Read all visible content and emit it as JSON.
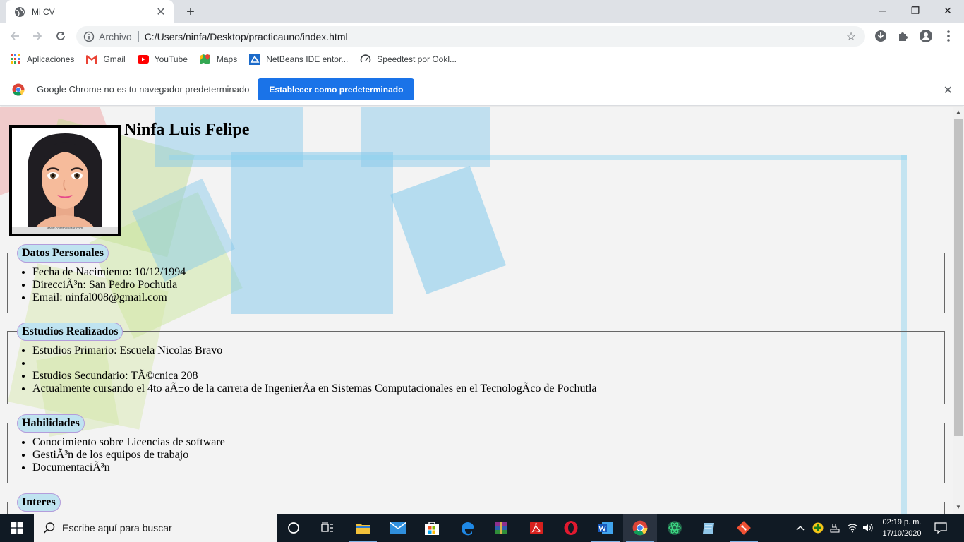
{
  "browser": {
    "tab_title": "Mi CV",
    "address_scheme": "Archivo",
    "address_url": "C:/Users/ninfa/Desktop/practicauno/index.html",
    "bookmarks": [
      {
        "label": "Aplicaciones",
        "icon": "apps-grid-icon"
      },
      {
        "label": "Gmail",
        "icon": "gmail-icon"
      },
      {
        "label": "YouTube",
        "icon": "youtube-icon"
      },
      {
        "label": "Maps",
        "icon": "maps-icon"
      },
      {
        "label": "NetBeans IDE entor...",
        "icon": "netbeans-icon"
      },
      {
        "label": "Speedtest por Ookl...",
        "icon": "speedtest-icon"
      }
    ],
    "infobar_message": "Google Chrome no es tu navegador predeterminado",
    "infobar_button": "Establecer como predeterminado"
  },
  "page": {
    "name": "Ninfa Luis Felipe",
    "photo_caption": "www.cowithavatar.com",
    "sections": [
      {
        "title": "Datos Personales",
        "items": [
          "Fecha de Nacimiento: 10/12/1994",
          "DirecciÃ³n: San Pedro Pochutla",
          "Email: ninfal008@gmail.com"
        ]
      },
      {
        "title": "Estudios Realizados",
        "items": [
          "Estudios Primario: Escuela Nicolas Bravo",
          "",
          "Estudios Secundario: TÃ©cnica 208",
          "Actualmente cursando el 4to aÃ±o de la carrera de IngenierÃa en Sistemas Computacionales en el TecnologÃco de Pochutla"
        ]
      },
      {
        "title": "Habilidades",
        "items": [
          "Conocimiento sobre Licencias de software",
          "GestiÃ³n de los equipos de trabajo",
          "DocumentaciÃ³n"
        ]
      },
      {
        "title": "Interes",
        "items": []
      }
    ]
  },
  "taskbar": {
    "search_placeholder": "Escribe aquí para buscar",
    "time": "02:19 p. m.",
    "date": "17/10/2020"
  }
}
